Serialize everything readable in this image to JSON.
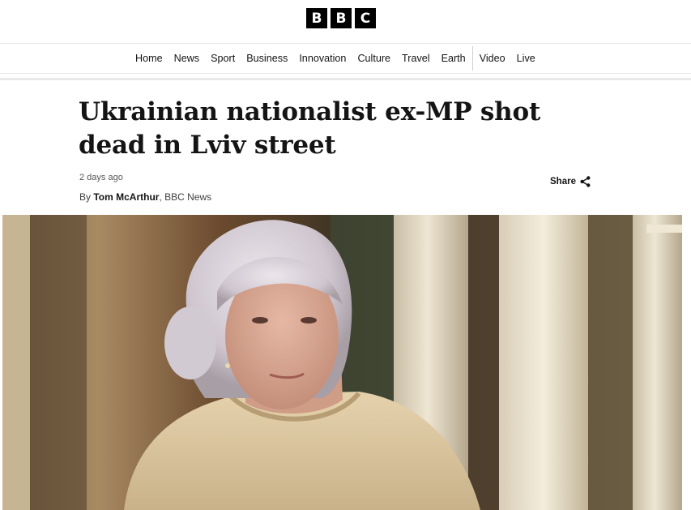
{
  "brand": {
    "logo_letters": [
      "B",
      "B",
      "C"
    ]
  },
  "nav": {
    "items": [
      {
        "label": "Home"
      },
      {
        "label": "News"
      },
      {
        "label": "Sport"
      },
      {
        "label": "Business"
      },
      {
        "label": "Innovation"
      },
      {
        "label": "Culture"
      },
      {
        "label": "Travel"
      },
      {
        "label": "Earth"
      },
      {
        "label": "Video"
      },
      {
        "label": "Live"
      }
    ]
  },
  "article": {
    "headline": "Ukrainian nationalist ex-MP shot dead in Lviv street",
    "timestamp": "2 days ago",
    "byline_prefix": "By ",
    "author": "Tom McArthur",
    "byline_sep": ", ",
    "outlet": "BBC News",
    "share_label": "Share",
    "share_icon": "share-icon"
  },
  "hero_image": {
    "subject": "photo-woman-portrait"
  },
  "colors": {
    "text": "#141414",
    "muted": "#545658",
    "logo_bg": "#000000"
  }
}
